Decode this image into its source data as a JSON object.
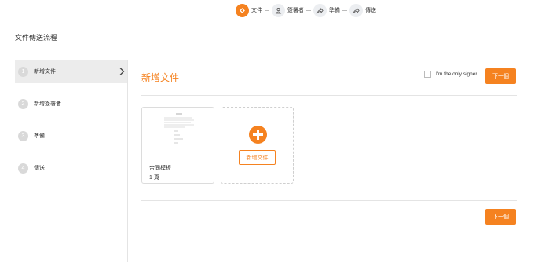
{
  "stepper": {
    "steps": [
      {
        "label": "文件",
        "icon": "document-icon",
        "active": true
      },
      {
        "label": "簽署者",
        "icon": "user-icon",
        "active": false
      },
      {
        "label": "準備",
        "icon": "share-icon",
        "active": false
      },
      {
        "label": "傳送",
        "icon": "share-icon",
        "active": false
      }
    ]
  },
  "page_title": "文件傳送流程",
  "sidebar": {
    "items": [
      {
        "number": "1",
        "label": "新增文件",
        "active": true
      },
      {
        "number": "2",
        "label": "新增簽署者",
        "active": false
      },
      {
        "number": "3",
        "label": "準備",
        "active": false
      },
      {
        "number": "4",
        "label": "傳送",
        "active": false
      }
    ]
  },
  "main": {
    "title": "新增文件",
    "only_signer_label": "I'm the only signer",
    "only_signer_checked": false,
    "next_label": "下一個",
    "document": {
      "name": "合同模板",
      "pages": "1 頁"
    },
    "add_document_label": "新增文件"
  },
  "colors": {
    "accent": "#f58220",
    "inactive_step": "#eceef1",
    "sidebar_active_bg": "#ececec"
  }
}
